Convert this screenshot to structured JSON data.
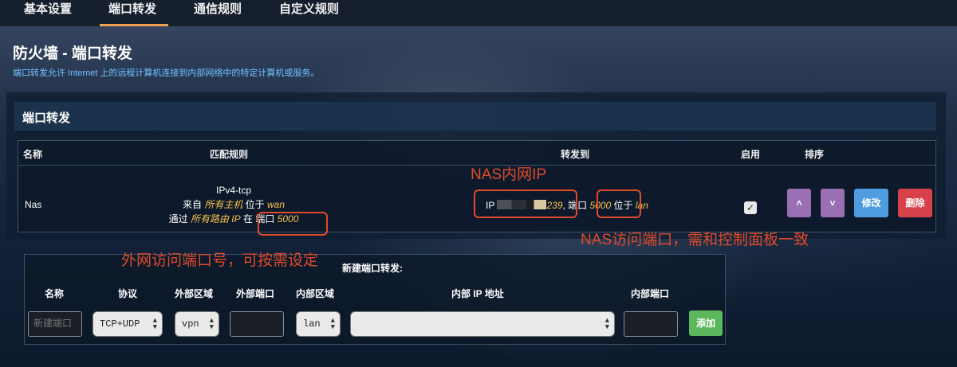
{
  "tabs": [
    {
      "label": "基本设置"
    },
    {
      "label": "端口转发"
    },
    {
      "label": "通信规则"
    },
    {
      "label": "自定义规则"
    }
  ],
  "page": {
    "title": "防火墙 - 端口转发",
    "description": "端口转发允许 Internet 上的远程计算机连接到内部网络中的特定计算机或服务。"
  },
  "section": {
    "title": "端口转发"
  },
  "table": {
    "headers": {
      "name": "名称",
      "match": "匹配规则",
      "forward": "转发到",
      "enable": "启用",
      "sort": "排序"
    },
    "row": {
      "name": "Nas",
      "protocol": "IPv4-tcp",
      "from_prefix": "来自 ",
      "from_host": "所有主机",
      "from_mid": " 位于 ",
      "from_zone": "wan",
      "via_prefix": "通过 ",
      "via_ip": "所有路由 IP",
      "via_mid": " 在 端口 ",
      "via_port": "5000",
      "fwd_ip_prefix": "IP ",
      "fwd_ip_tail": "239",
      "fwd_port_prefix": ", 端口 ",
      "fwd_port": "5000",
      "fwd_zone_prefix": " 位于 ",
      "fwd_zone": "lan",
      "enabled": "✓",
      "up": "˄",
      "down": "˅",
      "edit": "修改",
      "delete": "删除"
    }
  },
  "new_rule": {
    "title": "新建端口转发:",
    "headers": {
      "name": "名称",
      "protocol": "协议",
      "ext_zone": "外部区域",
      "ext_port": "外部端口",
      "int_zone": "内部区域",
      "int_ip": "内部 IP 地址",
      "int_port": "内部端口"
    },
    "name_placeholder": "新建端口",
    "protocol_value": "TCP+UDP",
    "ext_zone_value": "vpn",
    "int_zone_value": "lan",
    "add": "添加"
  },
  "annotations": {
    "nas_ip": "NAS内网IP",
    "nas_port": "NAS访问端口，需和控制面板一致",
    "ext_port": "外网访问端口号，可按需设定"
  },
  "colors": {
    "annotation": "#e04a2a",
    "highlight": "#f3c24a",
    "link_blue": "#6fc3ff"
  }
}
